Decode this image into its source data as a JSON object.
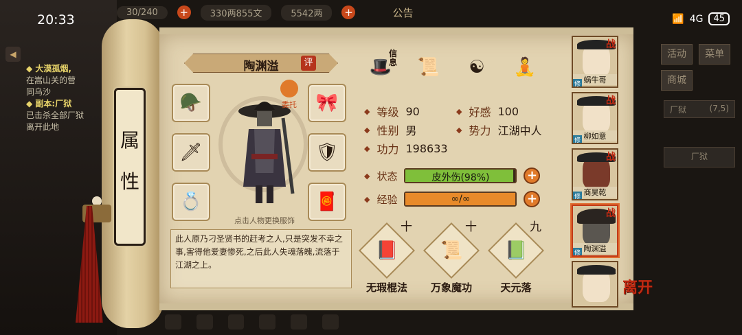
{
  "status": {
    "time": "20:33",
    "time_small": "20:33",
    "network": "4G",
    "battery": "45"
  },
  "topbar": {
    "resource_1": "30/240",
    "money": "330两855文",
    "ingot": "5542两",
    "notice": "公告"
  },
  "quest": {
    "title_1": "◆ 大漠孤烟,",
    "line_1a": "在嵩山关的营",
    "line_1b": "同乌沙",
    "title_2": "◆ 副本:厂狱",
    "line_2a": "已击杀全部厂狱",
    "line_2b": "离开此地"
  },
  "right_menu": {
    "activity": "活动",
    "menu": "菜单",
    "shop": "商城",
    "dungeon": "厂狱",
    "dungeon_count": "(7,5)",
    "dungeon_tab": "厂狱"
  },
  "scroll": {
    "label": "属性"
  },
  "character": {
    "name": "陶渊溢",
    "eval_label": "评",
    "delegate_label": "委托",
    "change_hint": "点击人物更换服饰",
    "bio": "此人原乃刁圣贤书的赶考之人,只是突发不幸之事,害得他爱妻惨死,之后此人失魂落魄,流落于江湖之上。"
  },
  "equipment": [
    {
      "icon": "helmet-icon",
      "glyph": "🪖"
    },
    {
      "icon": "sword-icon",
      "glyph": "🗡"
    },
    {
      "icon": "ring-icon",
      "glyph": "💍"
    },
    {
      "icon": "belt-icon",
      "glyph": "🎀"
    },
    {
      "icon": "armor-icon",
      "glyph": "🛡"
    },
    {
      "icon": "charm-icon",
      "glyph": "🧧"
    }
  ],
  "top_skills": [
    {
      "icon": "hat-skill-icon",
      "glyph": "🎩",
      "badge": "信息"
    },
    {
      "icon": "scroll-skill-icon",
      "glyph": "📜"
    },
    {
      "icon": "bagua-icon",
      "glyph": "☯"
    },
    {
      "icon": "meridian-icon",
      "glyph": "🧘"
    }
  ],
  "stats": {
    "level_label": "等级",
    "level": "90",
    "affinity_label": "好感",
    "affinity": "100",
    "gender_label": "性别",
    "gender": "男",
    "faction_label": "势力",
    "faction": "江湖中人",
    "power_label": "功力",
    "power": "198633"
  },
  "bars": {
    "status_label": "状态",
    "status_text": "皮外伤(98%)",
    "status_fill": 0.98,
    "exp_label": "经验",
    "exp_text": "∞/∞",
    "exp_fill": 1.0
  },
  "kungfu": [
    {
      "name": "无瑕棍法",
      "level": "十",
      "glyph": "📕"
    },
    {
      "name": "万象魔功",
      "level": "十",
      "glyph": "📜"
    },
    {
      "name": "天元落",
      "level": "九",
      "glyph": "📗"
    }
  ],
  "roster": [
    {
      "name": "蜗牛哥",
      "war": "战",
      "fix": "修"
    },
    {
      "name": "柳如意",
      "war": "战",
      "fix": "修"
    },
    {
      "name": "商昊乾",
      "war": "战",
      "fix": "修"
    },
    {
      "name": "陶渊溢",
      "war": "战",
      "fix": "修"
    },
    {
      "name": "",
      "war": "",
      "fix": ""
    }
  ],
  "leave_label": "离开",
  "colors": {
    "status_bar": "#7fbf3a",
    "exp_bar": "#e88a2a",
    "accent_red": "#c12a12"
  }
}
